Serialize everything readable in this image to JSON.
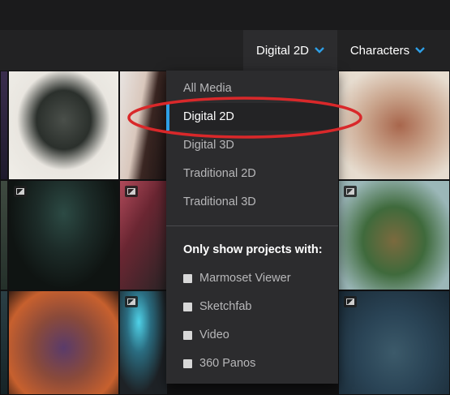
{
  "filters": {
    "medium_label": "Digital 2D",
    "subject_label": "Characters",
    "accent_color": "#2e9fe6",
    "chevron_icon": "chevron-down-icon"
  },
  "dropdown": {
    "items": [
      {
        "label": "All Media",
        "selected": false
      },
      {
        "label": "Digital 2D",
        "selected": true
      },
      {
        "label": "Digital 3D",
        "selected": false
      },
      {
        "label": "Traditional 2D",
        "selected": false
      },
      {
        "label": "Traditional 3D",
        "selected": false
      }
    ],
    "heading": "Only show projects with:",
    "checkboxes": [
      {
        "label": "Marmoset Viewer",
        "checked": false
      },
      {
        "label": "Sketchfab",
        "checked": false
      },
      {
        "label": "Video",
        "checked": false
      },
      {
        "label": "360 Panos",
        "checked": false
      }
    ]
  },
  "annotation": {
    "shape": "ellipse",
    "color": "#d9282a",
    "target": "Digital 2D"
  },
  "gallery": {
    "badge_icon": "image-badge-icon"
  }
}
